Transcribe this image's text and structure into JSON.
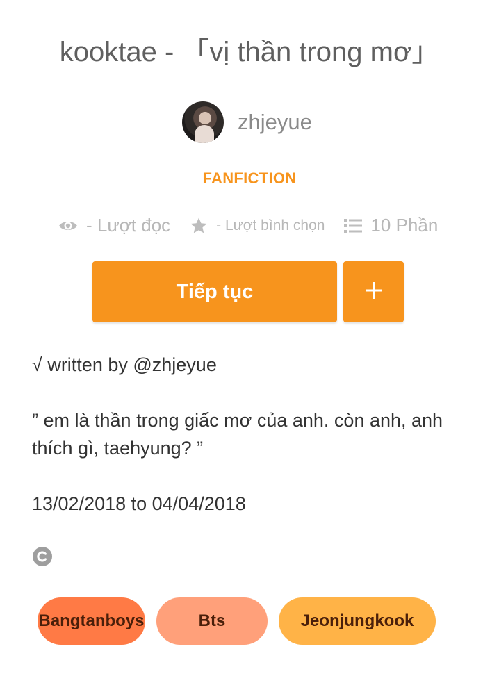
{
  "story": {
    "title": "kooktae  -  「vị thần trong mơ」",
    "author": "zhjeyue",
    "category": "FANFICTION"
  },
  "stats": {
    "reads_label": "- Lượt đọc",
    "votes_label": "- Lượt bình chọn",
    "parts_label": "10 Phần",
    "reads_icon": "eye-icon",
    "votes_icon": "star-icon",
    "parts_icon": "list-icon"
  },
  "actions": {
    "continue_label": "Tiếp tục",
    "add_icon": "plus-icon"
  },
  "description": {
    "line1": "√ written by @zhjeyue",
    "line2": "” em là thần trong giấc mơ của anh. còn anh, anh thích gì, taehyung? ”",
    "line3": "13/02/2018 to 04/04/2018",
    "copyright_icon": "copyright-icon"
  },
  "tags": [
    {
      "label": "Bangtanboys",
      "color": "#ff7a45"
    },
    {
      "label": "Bts",
      "color": "#ffa07a"
    },
    {
      "label": "Jeonjungkook",
      "color": "#ffb347"
    }
  ],
  "colors": {
    "accent": "#f7941d",
    "muted": "#b8b8b8"
  }
}
